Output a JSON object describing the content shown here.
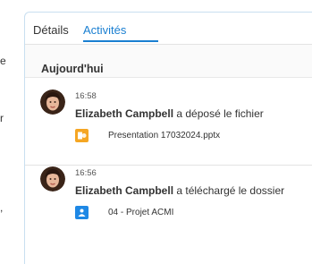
{
  "tabs": [
    {
      "label": "Détails",
      "active": false
    },
    {
      "label": "Activités",
      "active": true
    }
  ],
  "section_title": "Aujourd'hui",
  "activities": [
    {
      "time": "16:58",
      "user": "Elizabeth Campbell",
      "action": "a déposé le fichier",
      "attachment": {
        "name": "Presentation 17032024.pptx",
        "icon": "pptx-file-icon",
        "color": "#f5a623"
      }
    },
    {
      "time": "16:56",
      "user": "Elizabeth Campbell",
      "action": "a téléchargé le dossier",
      "attachment": {
        "name": "04 - Projet ACMI",
        "icon": "shared-folder-icon",
        "color": "#1e88e5"
      }
    }
  ],
  "left_edge_glyphs": [
    "e",
    "r",
    ","
  ],
  "colors": {
    "accent": "#1a7fd1",
    "panel_border": "#c9dff0"
  }
}
